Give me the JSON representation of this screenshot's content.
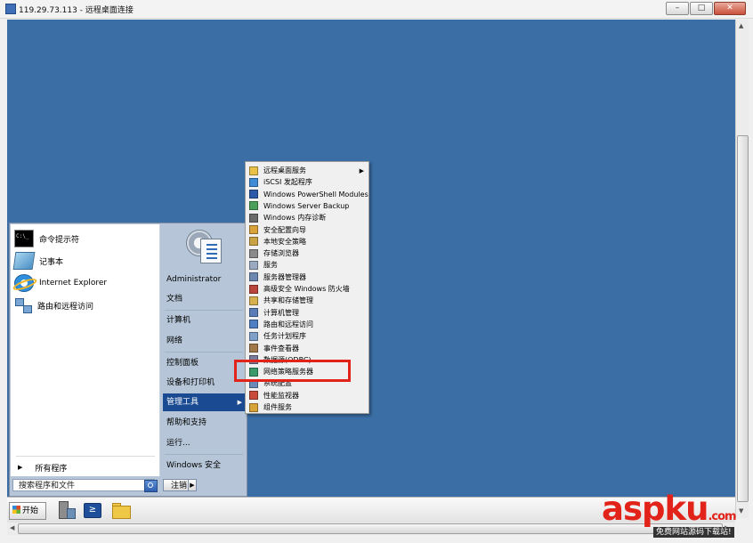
{
  "window": {
    "title": "119.29.73.113 - 远程桌面连接",
    "min_label": "–",
    "max_label": "□",
    "close_label": "✕"
  },
  "start_menu": {
    "pinned": [
      {
        "label": "命令提示符",
        "icon": "cmd-icon"
      },
      {
        "label": "记事本",
        "icon": "notepad-icon"
      },
      {
        "label": "Internet Explorer",
        "icon": "ie-icon"
      },
      {
        "label": "路由和远程访问",
        "icon": "network-icon"
      }
    ],
    "all_programs": "所有程序",
    "search_placeholder": "搜索程序和文件",
    "right_items": [
      {
        "label": "Administrator"
      },
      {
        "label": "文档"
      },
      {
        "label": "计算机"
      },
      {
        "label": "网络"
      },
      {
        "label": "控制面板"
      },
      {
        "label": "设备和打印机"
      },
      {
        "label": "管理工具",
        "highlighted": true,
        "has_submenu": true
      },
      {
        "label": "帮助和支持"
      },
      {
        "label": "运行..."
      },
      {
        "label": "Windows 安全"
      }
    ],
    "logoff": "注销",
    "logoff_arrow": "▶"
  },
  "admin_tools": [
    {
      "label": "远程桌面服务",
      "color": "#e9c24a",
      "has_submenu": true
    },
    {
      "label": "iSCSI 发起程序",
      "color": "#3d8bd4"
    },
    {
      "label": "Windows PowerShell Modules",
      "color": "#2a5aa8"
    },
    {
      "label": "Windows Server Backup",
      "color": "#4aa05a"
    },
    {
      "label": "Windows 内存诊断",
      "color": "#6a6a6a"
    },
    {
      "label": "安全配置向导",
      "color": "#d9a23a"
    },
    {
      "label": "本地安全策略",
      "color": "#c9a243"
    },
    {
      "label": "存储浏览器",
      "color": "#8a8a8a"
    },
    {
      "label": "服务",
      "color": "#9aaac0"
    },
    {
      "label": "服务器管理器",
      "color": "#6c88b0"
    },
    {
      "label": "高级安全 Windows 防火墙",
      "color": "#b8443a"
    },
    {
      "label": "共享和存储管理",
      "color": "#d6b04e"
    },
    {
      "label": "计算机管理",
      "color": "#5a7db8"
    },
    {
      "label": "路由和远程访问",
      "color": "#4d7fc2"
    },
    {
      "label": "任务计划程序",
      "color": "#7fa0c8"
    },
    {
      "label": "事件查看器",
      "color": "#a0784a"
    },
    {
      "label": "数据源(ODBC)",
      "color": "#7a7a9a"
    },
    {
      "label": "网络策略服务器",
      "color": "#3a9a6a"
    },
    {
      "label": "系统配置",
      "color": "#6a8ab8"
    },
    {
      "label": "性能监视器",
      "color": "#c84a3a"
    },
    {
      "label": "组件服务",
      "color": "#d8a43a"
    }
  ],
  "taskbar": {
    "start_label": "开始",
    "icons": [
      "server-manager-icon",
      "powershell-icon",
      "explorer-folder-icon"
    ],
    "powershell_glyph": "≥"
  },
  "watermark": {
    "brand_asp": "asp",
    "brand_ku": "ku",
    "brand_com": ".com",
    "tagline": "免费网站源码下载站!"
  },
  "colors": {
    "desktop": "#3a6ea5",
    "highlight": "#1a4a92",
    "redbox": "#e2231a"
  }
}
